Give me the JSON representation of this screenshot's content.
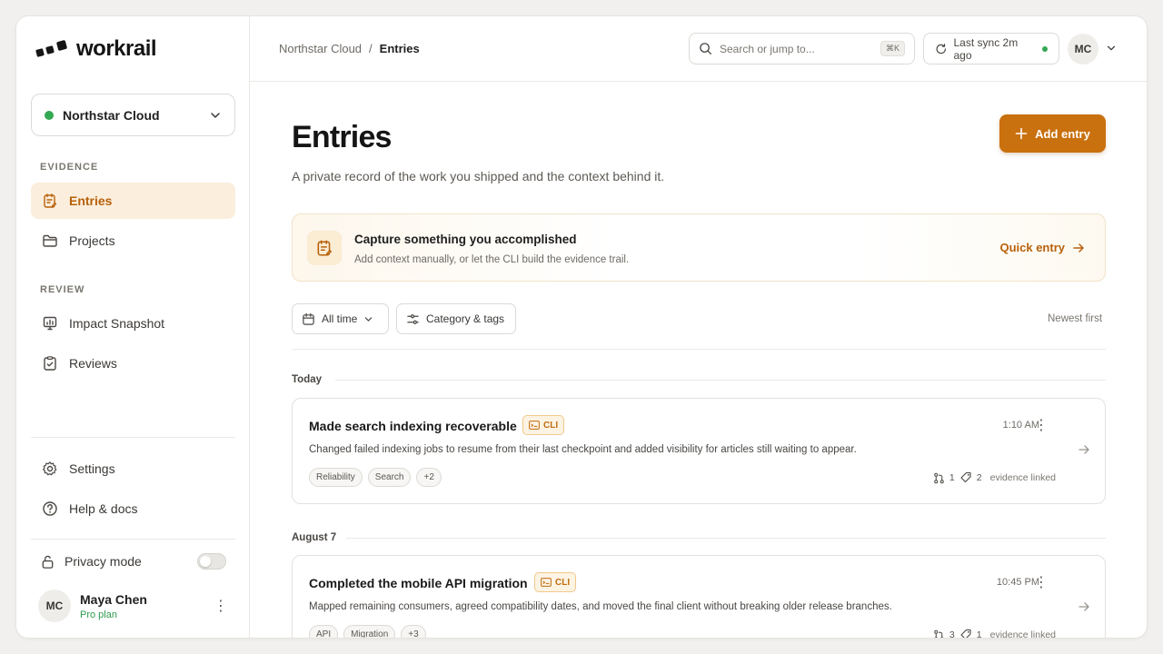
{
  "brand": {
    "name": "workrail"
  },
  "workspace": {
    "name": "Northstar Cloud",
    "status_color": "#34a853"
  },
  "sidebar": {
    "sections": [
      {
        "label": "EVIDENCE",
        "items": [
          {
            "label": "Entries",
            "icon": "entries-icon",
            "active": true
          },
          {
            "label": "Projects",
            "icon": "folder-icon"
          }
        ]
      },
      {
        "label": "REVIEW",
        "items": [
          {
            "label": "Impact Snapshot",
            "icon": "chart-icon"
          },
          {
            "label": "Reviews",
            "icon": "clipboard-icon"
          }
        ]
      }
    ],
    "footer_items": [
      {
        "label": "Settings",
        "icon": "gear-icon"
      },
      {
        "label": "Help & docs",
        "icon": "help-icon"
      }
    ],
    "privacy": {
      "label": "Privacy mode",
      "enabled": false
    },
    "user": {
      "initials": "MC",
      "name": "Maya Chen",
      "plan": "Pro plan"
    }
  },
  "topbar": {
    "breadcrumb": {
      "parent": "Northstar Cloud",
      "separator": "/",
      "current": "Entries"
    },
    "search": {
      "placeholder": "Search or jump to...",
      "shortcut": "⌘K"
    },
    "sync": {
      "label": "Last sync 2m ago"
    },
    "avatar_initials": "MC"
  },
  "page": {
    "title": "Entries",
    "subtitle": "A private record of the work you shipped and the context behind it.",
    "add_button": "Add entry"
  },
  "capture": {
    "title": "Capture something you accomplished",
    "subtitle": "Add context manually, or let the CLI build the evidence trail.",
    "action": "Quick entry"
  },
  "filters": {
    "time": "All time",
    "category": "Category & tags",
    "sort": "Newest first"
  },
  "groups": [
    {
      "label": "Today",
      "entries": [
        {
          "title": "Made search indexing recoverable",
          "badge": "CLI",
          "time": "1:10 AM",
          "description": "Changed failed indexing jobs to resume from their last checkpoint and added visibility for articles still waiting to appear.",
          "tags": [
            "Reliability",
            "Search",
            "+2"
          ],
          "pull_requests": "1",
          "commits": "2",
          "evidence_label": "evidence linked"
        }
      ]
    },
    {
      "label": "August 7",
      "entries": [
        {
          "title": "Completed the mobile API migration",
          "badge": "CLI",
          "time": "10:45 PM",
          "description": "Mapped remaining consumers, agreed compatibility dates, and moved the final client without breaking older release branches.",
          "tags": [
            "API",
            "Migration",
            "+3"
          ],
          "pull_requests": "3",
          "commits": "1",
          "evidence_label": "evidence linked"
        }
      ]
    }
  ],
  "colors": {
    "accent": "#c9700f",
    "accent_text": "#b7610a",
    "active_bg": "#fbeedd",
    "success": "#34a853"
  }
}
